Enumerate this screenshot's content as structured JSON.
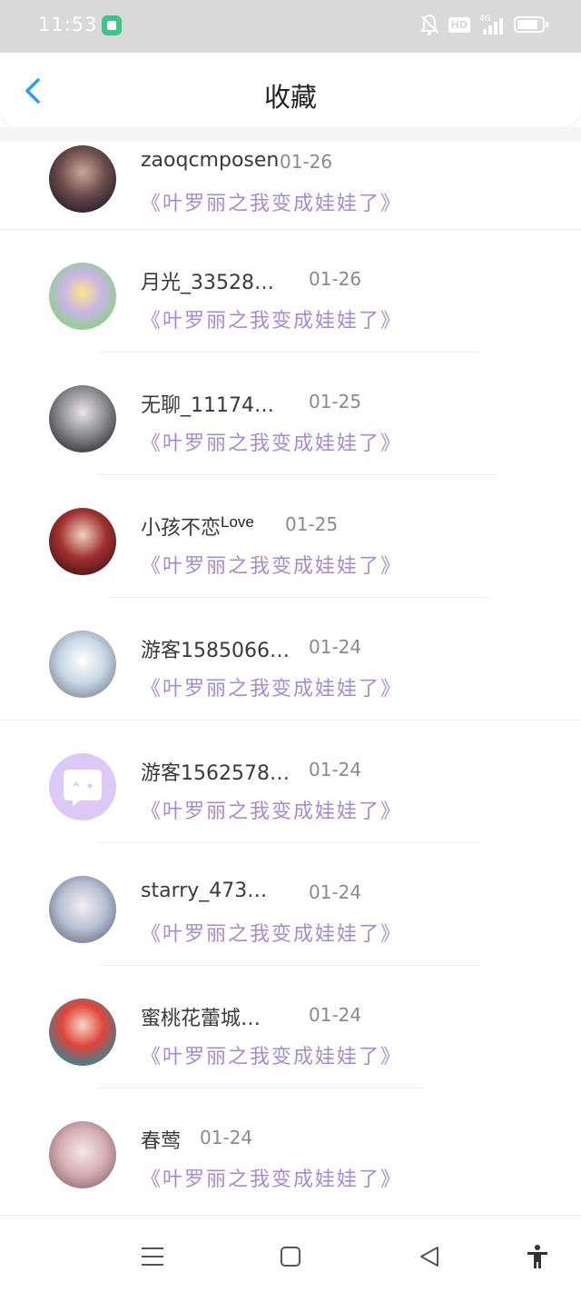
{
  "status_bar": {
    "time": "11:53",
    "hd_badge": "HD",
    "network": "4G",
    "icons": [
      "app-notification-icon",
      "bell-off-icon",
      "signal-icon",
      "battery-icon"
    ]
  },
  "header": {
    "title": "收藏",
    "back_icon": "chevron-left-icon"
  },
  "colors": {
    "accent": "#2a9df4",
    "book_title": "#a58bd6",
    "status_bar": "#d9d9d9"
  },
  "items": [
    {
      "user": "zaoqcmposen",
      "date": "01-26",
      "book": "《叶罗丽之我变成娃娃了》"
    },
    {
      "user": "月光_33528…",
      "date": "01-26",
      "book": "《叶罗丽之我变成娃娃了》"
    },
    {
      "user": "无聊_11174…",
      "date": "01-25",
      "book": "《叶罗丽之我变成娃娃了》"
    },
    {
      "user": "小孩不恋",
      "user_suffix": "Love",
      "date": "01-25",
      "book": "《叶罗丽之我变成娃娃了》"
    },
    {
      "user": "游客1585066…",
      "date": "01-24",
      "book": "《叶罗丽之我变成娃娃了》"
    },
    {
      "user": "游客1562578…",
      "date": "01-24",
      "book": "《叶罗丽之我变成娃娃了》"
    },
    {
      "user": "starry_473…",
      "date": "01-24",
      "book": "《叶罗丽之我变成娃娃了》"
    },
    {
      "user": "蜜桃花蕾城…",
      "date": "01-24",
      "book": "《叶罗丽之我变成娃娃了》"
    },
    {
      "user": "春莺",
      "date": "01-24",
      "book": "《叶罗丽之我变成娃娃了》"
    }
  ],
  "nav_bar": [
    "menu-icon",
    "home-square-icon",
    "back-triangle-icon",
    "accessibility-icon"
  ]
}
